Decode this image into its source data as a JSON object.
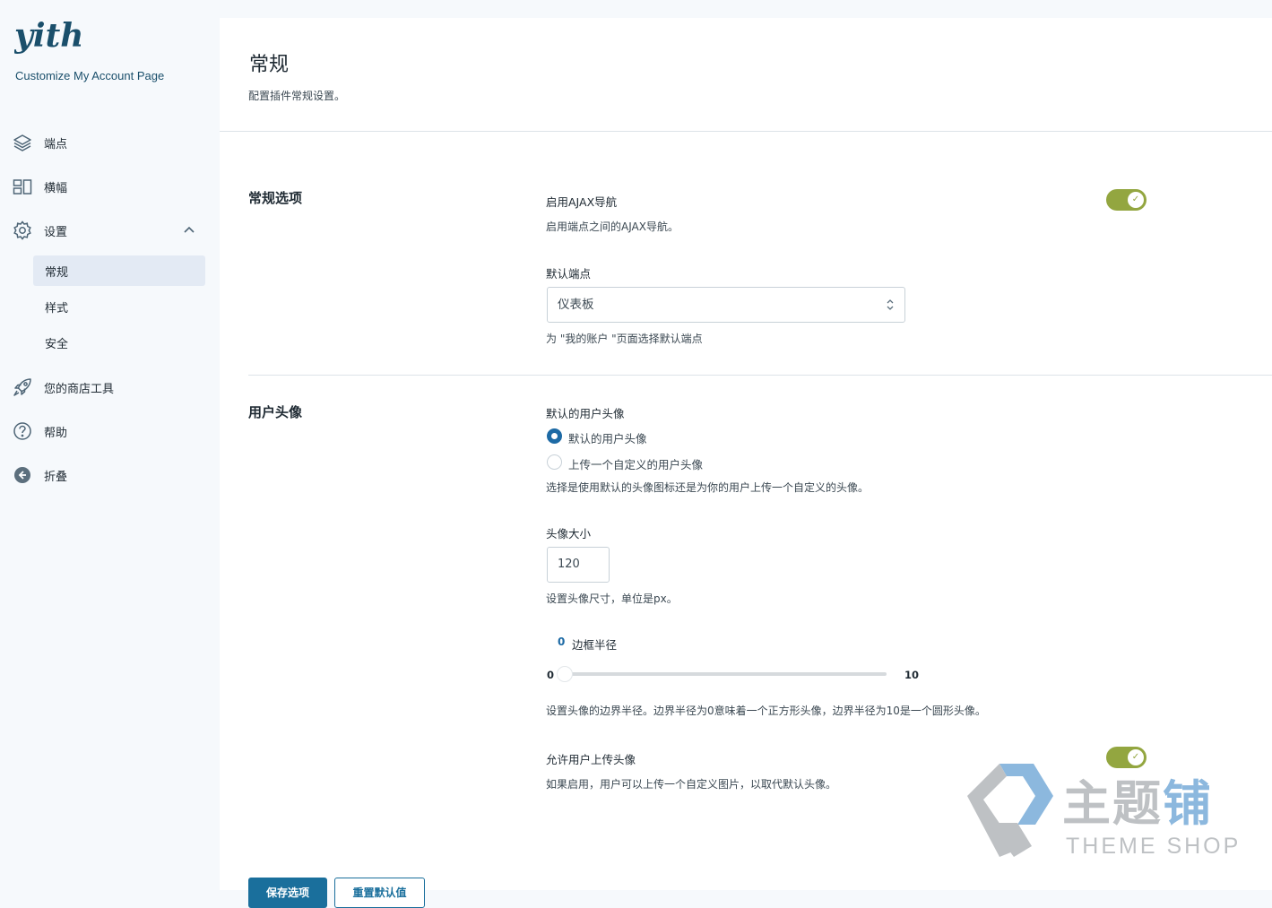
{
  "brand": {
    "logo_text": "yith",
    "subtitle": "Customize My Account Page"
  },
  "sidebar": {
    "items": [
      {
        "label": "端点",
        "icon": "layers-icon"
      },
      {
        "label": "横幅",
        "icon": "layout-icon"
      },
      {
        "label": "设置",
        "icon": "gear-icon",
        "expanded": true
      },
      {
        "label": "您的商店工具",
        "icon": "rocket-icon"
      },
      {
        "label": "帮助",
        "icon": "help-icon"
      },
      {
        "label": "折叠",
        "icon": "collapse-icon"
      }
    ],
    "sub_items": [
      {
        "label": "常规",
        "active": true
      },
      {
        "label": "样式"
      },
      {
        "label": "安全"
      }
    ]
  },
  "page": {
    "title": "常规",
    "description": "配置插件常规设置。"
  },
  "sections": {
    "general": {
      "title": "常规选项",
      "ajax": {
        "label": "启用AJAX导航",
        "hint": "启用端点之间的AJAX导航。",
        "enabled": true
      },
      "default_endpoint": {
        "label": "默认端点",
        "value": "仪表板",
        "hint": "为 \"我的账户 \"页面选择默认端点"
      }
    },
    "avatar": {
      "title": "用户头像",
      "default_avatar": {
        "label": "默认的用户头像",
        "options": [
          "默认的用户头像",
          "上传一个自定义的用户头像"
        ],
        "selected_index": 0,
        "hint": "选择是使用默认的头像图标还是为你的用户上传一个自定义的头像。"
      },
      "size": {
        "label": "头像大小",
        "value": "120",
        "hint": "设置头像尺寸，单位是px。"
      },
      "radius": {
        "label": "边框半径",
        "value": 0,
        "value_text": "0",
        "min": 0,
        "max": 10,
        "min_text": "0",
        "max_text": "10",
        "hint": "设置头像的边界半径。边界半径为0意味着一个正方形头像，边界半径为10是一个圆形头像。"
      },
      "allow_upload": {
        "label": "允许用户上传头像",
        "hint": "如果启用，用户可以上传一个自定义图片，以取代默认头像。",
        "enabled": true
      }
    }
  },
  "buttons": {
    "save": "保存选项",
    "reset": "重置默认值"
  },
  "watermark": {
    "title_gray": "主题",
    "title_blue": "铺",
    "subtitle": "THEME SHOP"
  },
  "colors": {
    "accent": "#1a6f9c",
    "toggle_on": "#93a640",
    "radio": "#1d6aa5",
    "brand": "#1a4f6b"
  }
}
